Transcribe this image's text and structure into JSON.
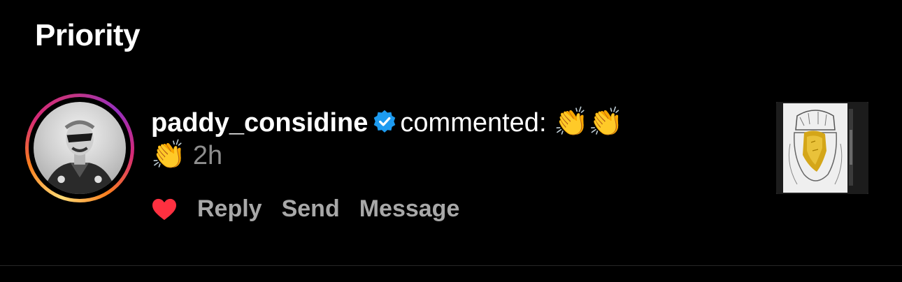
{
  "section": {
    "title": "Priority"
  },
  "notification": {
    "username": "paddy_considine",
    "verb": "commented:",
    "comment_emoji_line1": "👏👏",
    "comment_emoji_line2": "👏",
    "time": "2h",
    "avatar_icon": "user-avatar",
    "verified_icon": "verified-badge-icon",
    "thumbnail_icon": "post-thumbnail",
    "actions": {
      "like_icon": "heart-icon",
      "reply": "Reply",
      "send": "Send",
      "message": "Message"
    }
  },
  "colors": {
    "background": "#000000",
    "text_primary": "#ffffff",
    "text_secondary": "#a8a8a8",
    "like": "#ff3040",
    "verified": "#1d9bf0"
  }
}
